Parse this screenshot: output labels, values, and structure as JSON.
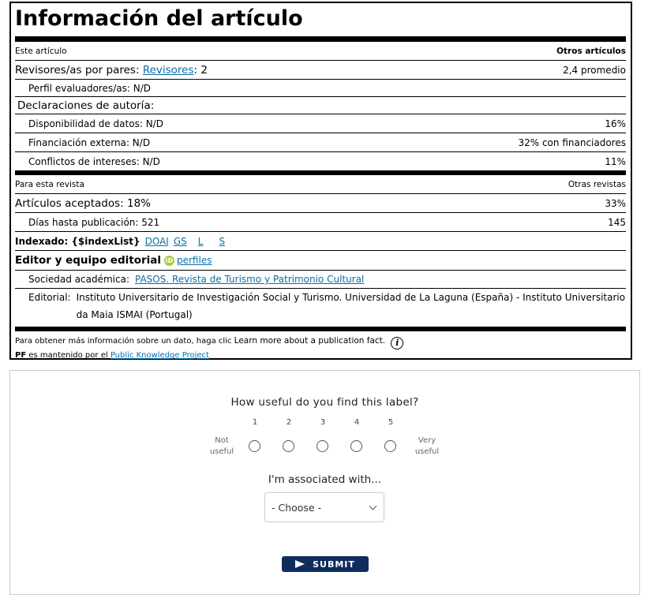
{
  "label": {
    "title": "Información del artículo",
    "article_section": {
      "left_header": "Este artículo",
      "right_header": "Otros artículos",
      "peer_review_prefix": "Revisores/as por pares:",
      "peer_review_link": "Revisores",
      "peer_review_count": ": 2",
      "peer_review_other": "2,4 promedio",
      "reviewer_profile": "Perfil evaluadores/as:  N/D",
      "authorship_heading": "Declaraciones de autoría:",
      "data_availability": "Disponibilidad de datos:  N/D",
      "data_availability_other": "16%",
      "external_funding": "Financiación externa:  N/D",
      "external_funding_other": "32% con financiadores",
      "conflicts": "Conflictos de intereses:  N/D",
      "conflicts_other": "11%"
    },
    "journal_section": {
      "left_header": "Para esta revista",
      "right_header": "Otras revistas",
      "accepted": "Artículos aceptados: 18%",
      "accepted_other": "33%",
      "days_to_pub": "Días hasta publicación:  521",
      "days_to_pub_other": "145",
      "indexed_label": "Indexado: {$indexList}",
      "index_links": [
        "DOAJ",
        "GS",
        "L",
        "S"
      ],
      "editor_heading": "Editor y equipo editorial",
      "orcid_badge": "iD",
      "profiles_link": "perfiles",
      "society_label": "Sociedad académica:",
      "society_link": "PASOS. Revista de Turismo y Patrimonio Cultural",
      "publisher_label": "Editorial:",
      "publisher_value": "Instituto Universitario de Investigación Social y Turismo. Universidad de La Laguna (España) - Instituto Universitario da Maia ISMAI (Portugal)"
    },
    "footer": {
      "more_info": "Para obtener más información sobre un dato, haga clic",
      "learn_more": "Learn more about a publication fact.",
      "info_icon": "i",
      "pf_abbr": "PF",
      "maintained_by": " es mantenido por el ",
      "pkp_link": "Public Knowledge Project"
    }
  },
  "survey": {
    "question": "How useful do you find this label?",
    "scale": [
      "1",
      "2",
      "3",
      "4",
      "5"
    ],
    "low_label": "Not useful",
    "high_label": "Very useful",
    "association_question": "I'm associated with...",
    "select_value": "- Choose -",
    "submit_label": "SUBMIT",
    "submit_color": "#0f2d5c"
  }
}
